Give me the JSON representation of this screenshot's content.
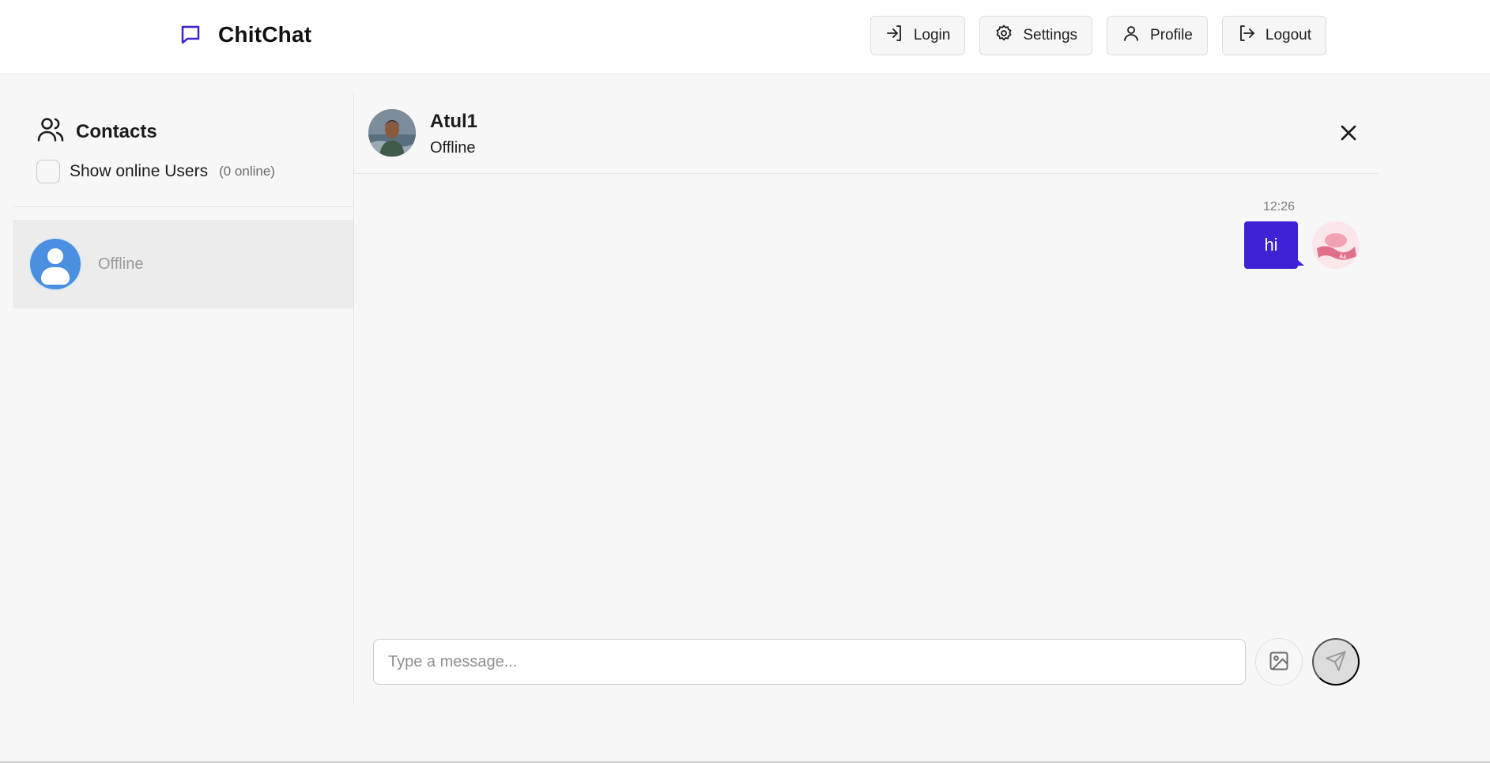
{
  "app": {
    "name": "ChitChat",
    "brand_color": "#3f22d6",
    "icon": "message-square-icon"
  },
  "nav": {
    "login": "Login",
    "settings": "Settings",
    "profile": "Profile",
    "logout": "Logout"
  },
  "sidebar": {
    "title": "Contacts",
    "filter_label": "Show online Users",
    "online_count": "(0 online)",
    "contacts": [
      {
        "status": "Offline"
      }
    ]
  },
  "chat": {
    "name": "Atul1",
    "status": "Offline",
    "messages": [
      {
        "time": "12:26",
        "text": "hi",
        "from": "me"
      }
    ],
    "input_placeholder": "Type a message..."
  }
}
